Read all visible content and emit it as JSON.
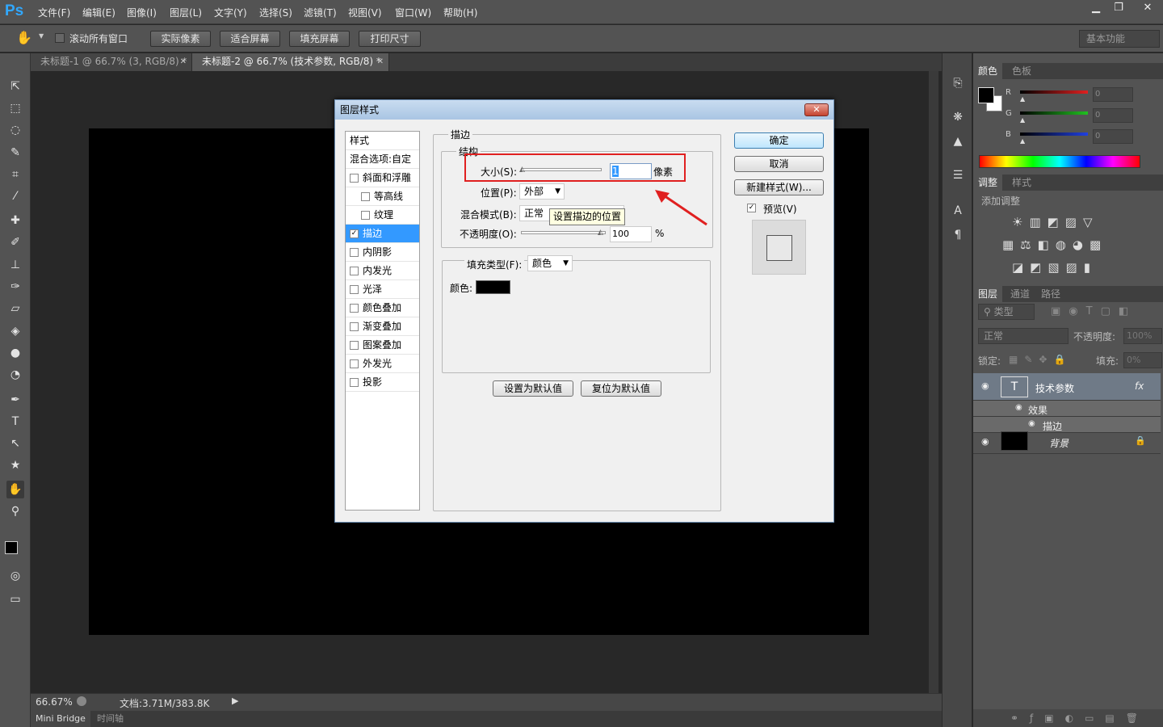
{
  "app": {
    "logo": "Ps"
  },
  "menu": [
    "文件(F)",
    "编辑(E)",
    "图像(I)",
    "图层(L)",
    "文字(Y)",
    "选择(S)",
    "滤镜(T)",
    "视图(V)",
    "窗口(W)",
    "帮助(H)"
  ],
  "window_controls": {
    "minimize": "▁",
    "restore": "❐",
    "close": "✕"
  },
  "options": {
    "scroll_all_label": "滚动所有窗口",
    "actual_pixels": "实际像素",
    "fit_screen": "适合屏幕",
    "fill_screen": "填充屏幕",
    "print_size": "打印尺寸",
    "workspace": "基本功能"
  },
  "tabs": [
    {
      "title": "未标题-1 @ 66.7% (3, RGB/8) *",
      "active": false
    },
    {
      "title": "未标题-2 @ 66.7% (技术参数, RGB/8) *",
      "active": true
    }
  ],
  "status": {
    "zoom": "66.67%",
    "doc": "文档:3.71M/383.8K"
  },
  "bottom_tabs": [
    "Mini Bridge",
    "时间轴"
  ],
  "color_panel": {
    "tabs": [
      "颜色",
      "色板"
    ],
    "channels": [
      {
        "name": "R",
        "value": "0",
        "color": "#e02020"
      },
      {
        "name": "G",
        "value": "0",
        "color": "#20c020"
      },
      {
        "name": "B",
        "value": "0",
        "color": "#2040e0"
      }
    ]
  },
  "adjust_panel": {
    "tabs": [
      "调整",
      "样式"
    ],
    "title": "添加调整"
  },
  "layers_panel": {
    "tabs": [
      "图层",
      "通道",
      "路径"
    ],
    "kind": "类型",
    "blend": "正常",
    "opacity_label": "不透明度:",
    "opacity": "100%",
    "lock_label": "锁定:",
    "fill_label": "填充:",
    "fill": "0%",
    "layers": [
      {
        "name": "技术参数",
        "fx": "fx",
        "effects_label": "效果",
        "effect": "描边"
      },
      {
        "name": "背景"
      }
    ]
  },
  "dialog": {
    "title": "图层样式",
    "style_list": [
      {
        "label": "样式",
        "checkbox": false,
        "checked": false
      },
      {
        "label": "混合选项:自定",
        "checkbox": false,
        "checked": false
      },
      {
        "label": "斜面和浮雕",
        "checkbox": true,
        "checked": false
      },
      {
        "label": "等高线",
        "checkbox": true,
        "checked": false,
        "indent": true
      },
      {
        "label": "纹理",
        "checkbox": true,
        "checked": false,
        "indent": true
      },
      {
        "label": "描边",
        "checkbox": true,
        "checked": true,
        "selected": true
      },
      {
        "label": "内阴影",
        "checkbox": true,
        "checked": false
      },
      {
        "label": "内发光",
        "checkbox": true,
        "checked": false
      },
      {
        "label": "光泽",
        "checkbox": true,
        "checked": false
      },
      {
        "label": "颜色叠加",
        "checkbox": true,
        "checked": false
      },
      {
        "label": "渐变叠加",
        "checkbox": true,
        "checked": false
      },
      {
        "label": "图案叠加",
        "checkbox": true,
        "checked": false
      },
      {
        "label": "外发光",
        "checkbox": true,
        "checked": false
      },
      {
        "label": "投影",
        "checkbox": true,
        "checked": false
      }
    ],
    "section": "描边",
    "structure": "结构",
    "size_label": "大小(S):",
    "size_value": "1",
    "size_unit": "像素",
    "size_fraction": 0.0,
    "position_label": "位置(P):",
    "position_value": "外部",
    "blend_label": "混合模式(B):",
    "blend_value": "正常",
    "tooltip": "设置描边的位置",
    "opacity_label": "不透明度(O):",
    "opacity_value": "100",
    "opacity_unit": "%",
    "fill_type_label": "填充类型(F):",
    "fill_type_value": "颜色",
    "color_label": "颜色:",
    "stroke_color": "#000000",
    "make_default": "设置为默认值",
    "reset_default": "复位为默认值",
    "ok": "确定",
    "cancel": "取消",
    "new_style": "新建样式(W)...",
    "preview_label": "预览(V)",
    "preview_checked": true
  }
}
